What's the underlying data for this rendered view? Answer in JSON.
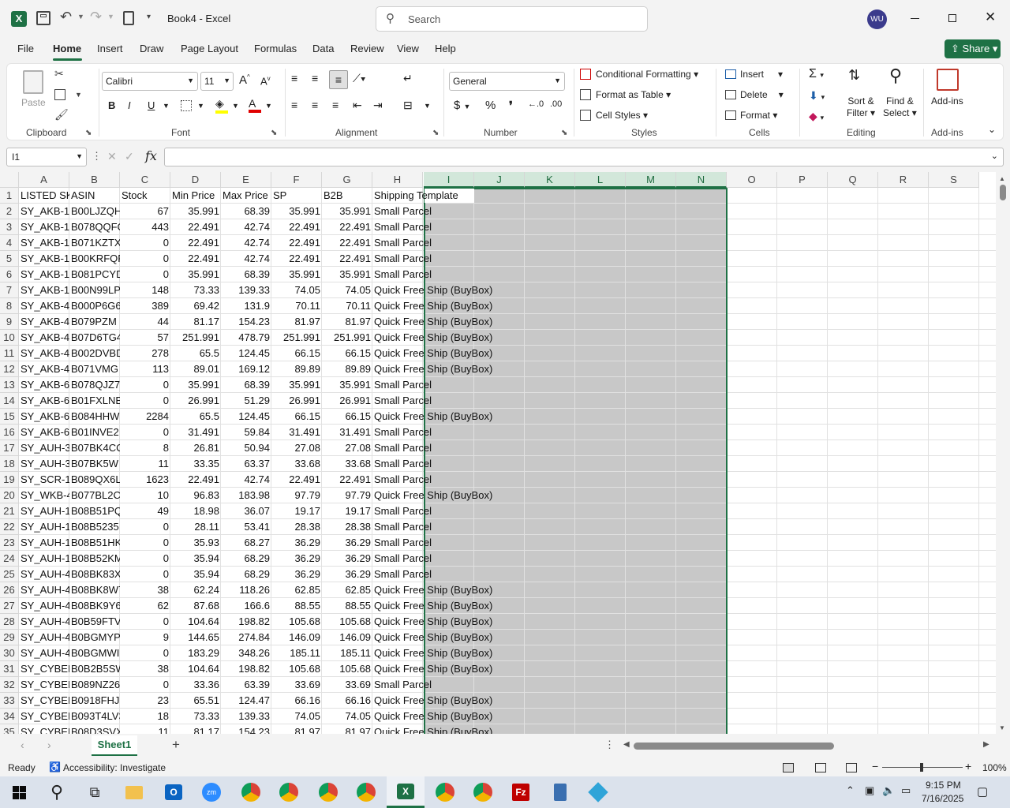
{
  "app": {
    "doc_title": "Book4  -  Excel",
    "search_placeholder": "Search",
    "user_initials": "WU"
  },
  "menu": {
    "tabs": [
      "File",
      "Home",
      "Insert",
      "Draw",
      "Page Layout",
      "Formulas",
      "Data",
      "Review",
      "View",
      "Help"
    ],
    "active": "Home",
    "share": "Share"
  },
  "ribbon": {
    "clipboard": {
      "paste": "Paste",
      "label": "Clipboard"
    },
    "font": {
      "name": "Calibri",
      "size": "11",
      "label": "Font"
    },
    "alignment": {
      "label": "Alignment"
    },
    "number": {
      "format": "General",
      "label": "Number"
    },
    "styles": {
      "cond": "Conditional Formatting",
      "table": "Format as Table",
      "cell": "Cell Styles",
      "label": "Styles"
    },
    "cells": {
      "insert": "Insert",
      "delete": "Delete",
      "format": "Format",
      "label": "Cells"
    },
    "editing": {
      "sort1": "Sort &",
      "sort2": "Filter",
      "find1": "Find &",
      "find2": "Select",
      "label": "Editing"
    },
    "addins": {
      "name": "Add-ins",
      "label": "Add-ins"
    }
  },
  "formula_bar": {
    "name_box": "I1",
    "fx": "fx",
    "content": ""
  },
  "columns": [
    "A",
    "B",
    "C",
    "D",
    "E",
    "F",
    "G",
    "H",
    "I",
    "J",
    "K",
    "L",
    "M",
    "N",
    "O",
    "P",
    "Q",
    "R",
    "S"
  ],
  "selected_columns": [
    "I",
    "J",
    "K",
    "L",
    "M",
    "N"
  ],
  "header_row": [
    "LISTED SKU",
    "ASIN",
    "Stock",
    "Min Price",
    "Max Price",
    "SP",
    "B2B",
    "Shipping Template"
  ],
  "rows": [
    [
      "SY_AKB-1",
      "B00LJZQH",
      "67",
      "35.991",
      "68.39",
      "35.991",
      "35.991",
      "Small Parcel"
    ],
    [
      "SY_AKB-1",
      "B078QQFC",
      "443",
      "22.491",
      "42.74",
      "22.491",
      "22.491",
      "Small Parcel"
    ],
    [
      "SY_AKB-1",
      "B071KZTX",
      "0",
      "22.491",
      "42.74",
      "22.491",
      "22.491",
      "Small Parcel"
    ],
    [
      "SY_AKB-1",
      "B00KRFQF",
      "0",
      "22.491",
      "42.74",
      "22.491",
      "22.491",
      "Small Parcel"
    ],
    [
      "SY_AKB-1",
      "B081PCYD",
      "0",
      "35.991",
      "68.39",
      "35.991",
      "35.991",
      "Small Parcel"
    ],
    [
      "SY_AKB-1",
      "B00N99LP",
      "148",
      "73.33",
      "139.33",
      "74.05",
      "74.05",
      "Quick Free Ship (BuyBox)"
    ],
    [
      "SY_AKB-4",
      "B000P6G6",
      "389",
      "69.42",
      "131.9",
      "70.11",
      "70.11",
      "Quick Free Ship (BuyBox)"
    ],
    [
      "SY_AKB-4",
      "B079PZM",
      "44",
      "81.17",
      "154.23",
      "81.97",
      "81.97",
      "Quick Free Ship (BuyBox)"
    ],
    [
      "SY_AKB-4",
      "B07D6TG4",
      "57",
      "251.991",
      "478.79",
      "251.991",
      "251.991",
      "Quick Free Ship (BuyBox)"
    ],
    [
      "SY_AKB-4",
      "B002DVBD",
      "278",
      "65.5",
      "124.45",
      "66.15",
      "66.15",
      "Quick Free Ship (BuyBox)"
    ],
    [
      "SY_AKB-4",
      "B071VMG",
      "113",
      "89.01",
      "169.12",
      "89.89",
      "89.89",
      "Quick Free Ship (BuyBox)"
    ],
    [
      "SY_AKB-6",
      "B078QJZ7",
      "0",
      "35.991",
      "68.39",
      "35.991",
      "35.991",
      "Small Parcel"
    ],
    [
      "SY_AKB-6",
      "B01FXLNE",
      "0",
      "26.991",
      "51.29",
      "26.991",
      "26.991",
      "Small Parcel"
    ],
    [
      "SY_AKB-6",
      "B084HHW",
      "2284",
      "65.5",
      "124.45",
      "66.15",
      "66.15",
      "Quick Free Ship (BuyBox)"
    ],
    [
      "SY_AKB-6",
      "B01INVE2",
      "0",
      "31.491",
      "59.84",
      "31.491",
      "31.491",
      "Small Parcel"
    ],
    [
      "SY_AUH-3",
      "B07BK4CC",
      "8",
      "26.81",
      "50.94",
      "27.08",
      "27.08",
      "Small Parcel"
    ],
    [
      "SY_AUH-3",
      "B07BK5W",
      "11",
      "33.35",
      "63.37",
      "33.68",
      "33.68",
      "Small Parcel"
    ],
    [
      "SY_SCR-1",
      "B089QX6L",
      "1623",
      "22.491",
      "42.74",
      "22.491",
      "22.491",
      "Small Parcel"
    ],
    [
      "SY_WKB-4",
      "B077BL2C",
      "10",
      "96.83",
      "183.98",
      "97.79",
      "97.79",
      "Quick Free Ship (BuyBox)"
    ],
    [
      "SY_AUH-1",
      "B08B51PQ",
      "49",
      "18.98",
      "36.07",
      "19.17",
      "19.17",
      "Small Parcel"
    ],
    [
      "SY_AUH-1",
      "B08B5235",
      "0",
      "28.11",
      "53.41",
      "28.38",
      "28.38",
      "Small Parcel"
    ],
    [
      "SY_AUH-1",
      "B08B51HK",
      "0",
      "35.93",
      "68.27",
      "36.29",
      "36.29",
      "Small Parcel"
    ],
    [
      "SY_AUH-1",
      "B08B52KM",
      "0",
      "35.94",
      "68.29",
      "36.29",
      "36.29",
      "Small Parcel"
    ],
    [
      "SY_AUH-4",
      "B08BK83X",
      "0",
      "35.94",
      "68.29",
      "36.29",
      "36.29",
      "Small Parcel"
    ],
    [
      "SY_AUH-4",
      "B08BK8W7",
      "38",
      "62.24",
      "118.26",
      "62.85",
      "62.85",
      "Quick Free Ship (BuyBox)"
    ],
    [
      "SY_AUH-4",
      "B08BK9Y6",
      "62",
      "87.68",
      "166.6",
      "88.55",
      "88.55",
      "Quick Free Ship (BuyBox)"
    ],
    [
      "SY_AUH-4",
      "B0B59FTV",
      "0",
      "104.64",
      "198.82",
      "105.68",
      "105.68",
      "Quick Free Ship (BuyBox)"
    ],
    [
      "SY_AUH-4",
      "B0BGMYP",
      "9",
      "144.65",
      "274.84",
      "146.09",
      "146.09",
      "Quick Free Ship (BuyBox)"
    ],
    [
      "SY_AUH-4",
      "B0BGMWI",
      "0",
      "183.29",
      "348.26",
      "185.11",
      "185.11",
      "Quick Free Ship (BuyBox)"
    ],
    [
      "SY_CYBER",
      "B0B2B5SW",
      "38",
      "104.64",
      "198.82",
      "105.68",
      "105.68",
      "Quick Free Ship (BuyBox)"
    ],
    [
      "SY_CYBER",
      "B089NZ26",
      "0",
      "33.36",
      "63.39",
      "33.69",
      "33.69",
      "Small Parcel"
    ],
    [
      "SY_CYBER",
      "B0918FHJ",
      "23",
      "65.51",
      "124.47",
      "66.16",
      "66.16",
      "Quick Free Ship (BuyBox)"
    ],
    [
      "SY_CYBER",
      "B093T4LV3",
      "18",
      "73.33",
      "139.33",
      "74.05",
      "74.05",
      "Quick Free Ship (BuyBox)"
    ],
    [
      "SY_CYBER",
      "B08D3SVX",
      "11",
      "81.17",
      "154.23",
      "81.97",
      "81.97",
      "Quick Free Ship (BuyBox)"
    ]
  ],
  "sheet": {
    "tab": "Sheet1"
  },
  "status": {
    "ready": "Ready",
    "accessibility": "Accessibility: Investigate",
    "zoom": "100%"
  },
  "clock": {
    "time": "9:15 PM",
    "date": "7/16/2025"
  },
  "colors": {
    "excel_green": "#1e7145",
    "share_green": "#1e7145",
    "selection_fill": "#c8c8c8"
  }
}
